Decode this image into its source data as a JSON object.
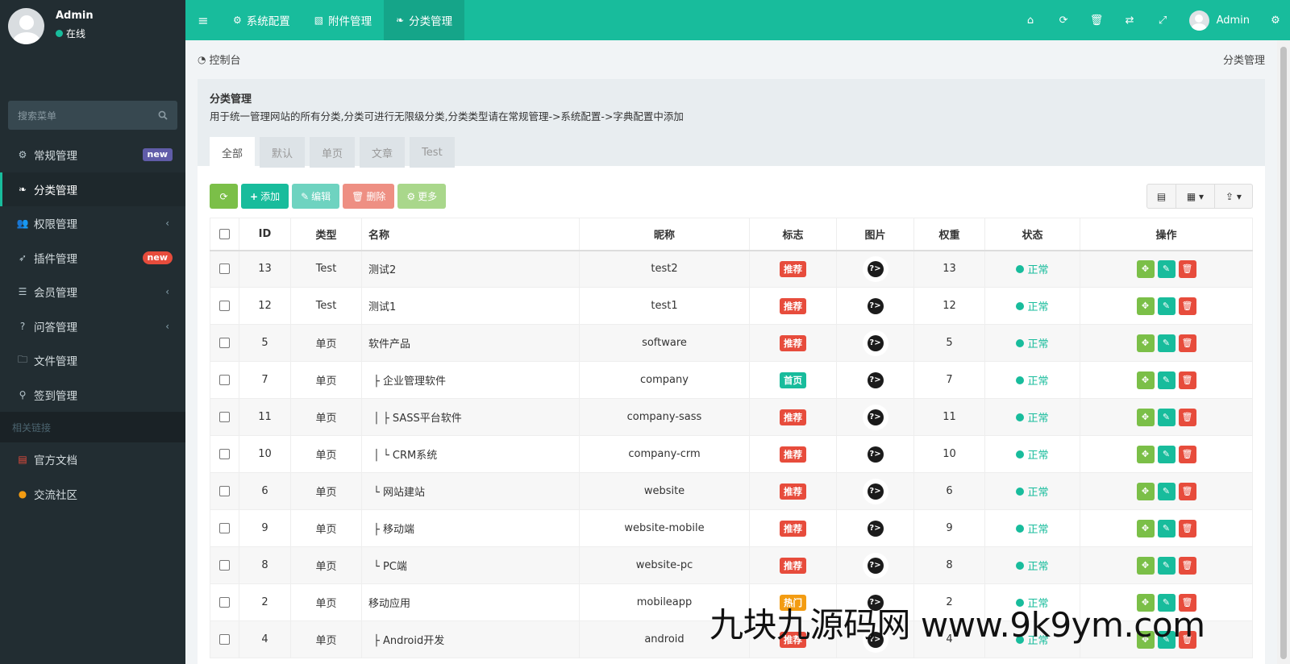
{
  "sidebar": {
    "user": {
      "name": "Admin",
      "status": "在线"
    },
    "search_placeholder": "搜索菜单",
    "items": [
      {
        "label": "常规管理",
        "icon": "cogs-icon",
        "badge": "new",
        "badge_color": "#605ca8"
      },
      {
        "label": "分类管理",
        "icon": "leaf-icon",
        "active": true
      },
      {
        "label": "权限管理",
        "icon": "group-icon",
        "chevron": true
      },
      {
        "label": "插件管理",
        "icon": "rocket-icon",
        "badge": "new",
        "badge_color": "#e74c3c"
      },
      {
        "label": "会员管理",
        "icon": "list-icon",
        "chevron": true
      },
      {
        "label": "问答管理",
        "icon": "question-circle-icon",
        "chevron": true
      },
      {
        "label": "文件管理",
        "icon": "folder-icon"
      },
      {
        "label": "签到管理",
        "icon": "map-marker-icon"
      }
    ],
    "links_header": "相关链接",
    "links": [
      {
        "label": "官方文档",
        "icon": "list-alt-icon"
      },
      {
        "label": "交流社区",
        "icon": "comment-icon"
      }
    ]
  },
  "topnav": {
    "tabs": [
      {
        "label": "系统配置",
        "icon": "cog-icon"
      },
      {
        "label": "附件管理",
        "icon": "file-image-icon"
      },
      {
        "label": "分类管理",
        "icon": "leaf-icon",
        "active": true
      }
    ],
    "user": "Admin",
    "right_icons": [
      "home-icon",
      "refresh-icon",
      "trash-icon",
      "translate-icon",
      "expand-icon",
      "cogs-icon"
    ]
  },
  "breadcrumb": {
    "left": "控制台",
    "right": "分类管理"
  },
  "panel": {
    "title": "分类管理",
    "description": "用于统一管理网站的所有分类,分类可进行无限级分类,分类类型请在常规管理->系统配置->字典配置中添加",
    "tabs": [
      "全部",
      "默认",
      "单页",
      "文章",
      "Test"
    ]
  },
  "toolbar": {
    "add": "添加",
    "edit": "编辑",
    "delete": "删除",
    "more": "更多"
  },
  "table": {
    "headers": [
      "ID",
      "类型",
      "名称",
      "昵称",
      "标志",
      "图片",
      "权重",
      "状态",
      "操作"
    ],
    "rows": [
      {
        "id": "13",
        "type": "Test",
        "name": "测试2",
        "nick": "test2",
        "flag": "推荐",
        "flag_color": "red",
        "weigh": "13",
        "status": "正常"
      },
      {
        "id": "12",
        "type": "Test",
        "name": "测试1",
        "nick": "test1",
        "flag": "推荐",
        "flag_color": "red",
        "weigh": "12",
        "status": "正常"
      },
      {
        "id": "5",
        "type": "单页",
        "name": "软件产品",
        "nick": "software",
        "flag": "推荐",
        "flag_color": "red",
        "weigh": "5",
        "status": "正常"
      },
      {
        "id": "7",
        "type": "单页",
        "name": "├ 企业管理软件",
        "nick": "company",
        "flag": "首页",
        "flag_color": "teal",
        "weigh": "7",
        "status": "正常"
      },
      {
        "id": "11",
        "type": "单页",
        "name": "│ ├ SASS平台软件",
        "nick": "company-sass",
        "flag": "推荐",
        "flag_color": "red",
        "weigh": "11",
        "status": "正常"
      },
      {
        "id": "10",
        "type": "单页",
        "name": "│ └ CRM系统",
        "nick": "company-crm",
        "flag": "推荐",
        "flag_color": "red",
        "weigh": "10",
        "status": "正常"
      },
      {
        "id": "6",
        "type": "单页",
        "name": "└ 网站建站",
        "nick": "website",
        "flag": "推荐",
        "flag_color": "red",
        "weigh": "6",
        "status": "正常"
      },
      {
        "id": "9",
        "type": "单页",
        "name": "├ 移动端",
        "nick": "website-mobile",
        "flag": "推荐",
        "flag_color": "red",
        "weigh": "9",
        "status": "正常"
      },
      {
        "id": "8",
        "type": "单页",
        "name": "└ PC端",
        "nick": "website-pc",
        "flag": "推荐",
        "flag_color": "red",
        "weigh": "8",
        "status": "正常"
      },
      {
        "id": "2",
        "type": "单页",
        "name": "移动应用",
        "nick": "mobileapp",
        "flag": "热门",
        "flag_color": "yellow",
        "weigh": "2",
        "status": "正常"
      },
      {
        "id": "4",
        "type": "单页",
        "name": "├ Android开发",
        "nick": "android",
        "flag": "推荐",
        "flag_color": "red",
        "weigh": "4",
        "status": "正常"
      }
    ]
  },
  "watermark": "九块九源码网 www.9k9ym.com",
  "colors": {
    "primary": "#18bc9c",
    "sidebar": "#222d32",
    "danger": "#e74c3c",
    "success": "#7bbf48",
    "warning": "#f39c12"
  }
}
